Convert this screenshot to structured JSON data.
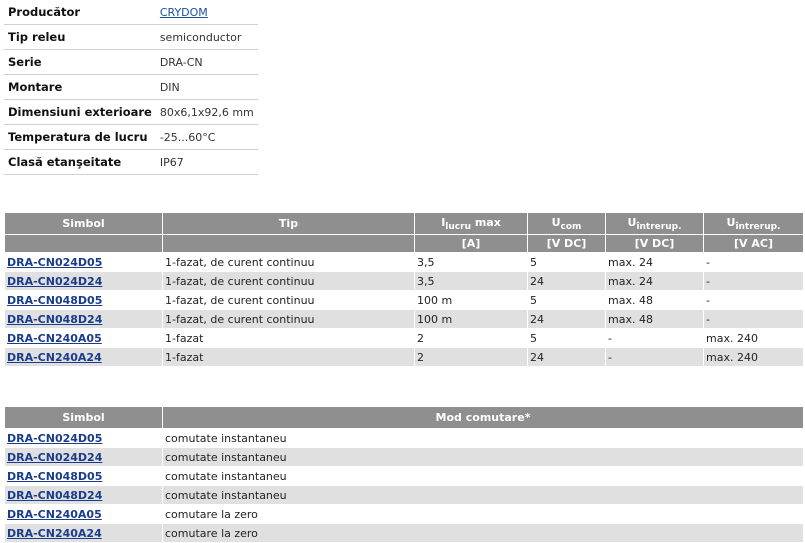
{
  "properties": [
    {
      "label": "Producător",
      "value": "CRYDOM",
      "link": true
    },
    {
      "label": "Tip releu",
      "value": "semiconductor",
      "link": false
    },
    {
      "label": "Serie",
      "value": "DRA-CN",
      "link": false
    },
    {
      "label": "Montare",
      "value": "DIN",
      "link": false
    },
    {
      "label": "Dimensiuni exterioare",
      "value": "80x6,1x92,6 mm",
      "link": false
    },
    {
      "label": "Temperatura de lucru",
      "value": "-25...60°C",
      "link": false
    },
    {
      "label": "Clasă etanşeitate",
      "value": "IP67",
      "link": false
    }
  ],
  "specs_table": {
    "headers": [
      {
        "main": "Simbol",
        "sub": "",
        "tail": ""
      },
      {
        "main": "Tip",
        "sub": "",
        "tail": ""
      },
      {
        "main": "I",
        "sub": "lucru",
        "tail": " max"
      },
      {
        "main": "U",
        "sub": "com",
        "tail": ""
      },
      {
        "main": "U",
        "sub": "întrerup.",
        "tail": ""
      },
      {
        "main": "U",
        "sub": "întrerup.",
        "tail": ""
      }
    ],
    "units": [
      "",
      "",
      "[A]",
      "[V DC]",
      "[V DC]",
      "[V AC]"
    ],
    "rows": [
      {
        "symbol": "DRA-CN024D05",
        "type": "1-fazat, de curent continuu",
        "current": "3,5",
        "ucom": "5",
        "udc": "max. 24",
        "uac": "-"
      },
      {
        "symbol": "DRA-CN024D24",
        "type": "1-fazat, de curent continuu",
        "current": "3,5",
        "ucom": "24",
        "udc": "max. 24",
        "uac": "-"
      },
      {
        "symbol": "DRA-CN048D05",
        "type": "1-fazat, de curent continuu",
        "current": "100 m",
        "ucom": "5",
        "udc": "max. 48",
        "uac": "-"
      },
      {
        "symbol": "DRA-CN048D24",
        "type": "1-fazat, de curent continuu",
        "current": "100 m",
        "ucom": "24",
        "udc": "max. 48",
        "uac": "-"
      },
      {
        "symbol": "DRA-CN240A05",
        "type": "1-fazat",
        "current": "2",
        "ucom": "5",
        "udc": "-",
        "uac": "max. 240"
      },
      {
        "symbol": "DRA-CN240A24",
        "type": "1-fazat",
        "current": "2",
        "ucom": "24",
        "udc": "-",
        "uac": "max. 240"
      }
    ]
  },
  "modes_table": {
    "headers": [
      "Simbol",
      "Mod comutare*"
    ],
    "rows": [
      {
        "symbol": "DRA-CN024D05",
        "mode": "comutate instantaneu"
      },
      {
        "symbol": "DRA-CN024D24",
        "mode": "comutate instantaneu"
      },
      {
        "symbol": "DRA-CN048D05",
        "mode": "comutate instantaneu"
      },
      {
        "symbol": "DRA-CN048D24",
        "mode": "comutate instantaneu"
      },
      {
        "symbol": "DRA-CN240A05",
        "mode": "comutare la zero"
      },
      {
        "symbol": "DRA-CN240A24",
        "mode": "comutare la zero"
      }
    ]
  },
  "colors": {
    "header_bg": "#8f8f8f",
    "row_alt_bg": "#e0e0e0",
    "link": "#1a3c8c"
  }
}
